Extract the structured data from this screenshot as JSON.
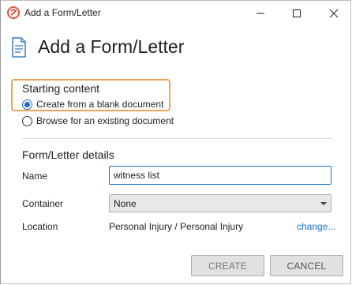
{
  "window": {
    "title": "Add a Form/Letter"
  },
  "header": {
    "title": "Add a Form/Letter",
    "icon": "document-icon"
  },
  "starting_content": {
    "heading": "Starting content",
    "options": [
      {
        "label": "Create from a blank document",
        "selected": true
      },
      {
        "label": "Browse for an existing document",
        "selected": false
      }
    ]
  },
  "details": {
    "heading": "Form/Letter details",
    "name_label": "Name",
    "name_value": "witness list",
    "container_label": "Container",
    "container_value": "None",
    "location_label": "Location",
    "location_value": "Personal Injury / Personal Injury",
    "change_link": "change..."
  },
  "buttons": {
    "create": "CREATE",
    "cancel": "CANCEL"
  },
  "colors": {
    "accent": "#1a6fd1",
    "highlight": "#f0a257",
    "brand": "#e8533f"
  }
}
